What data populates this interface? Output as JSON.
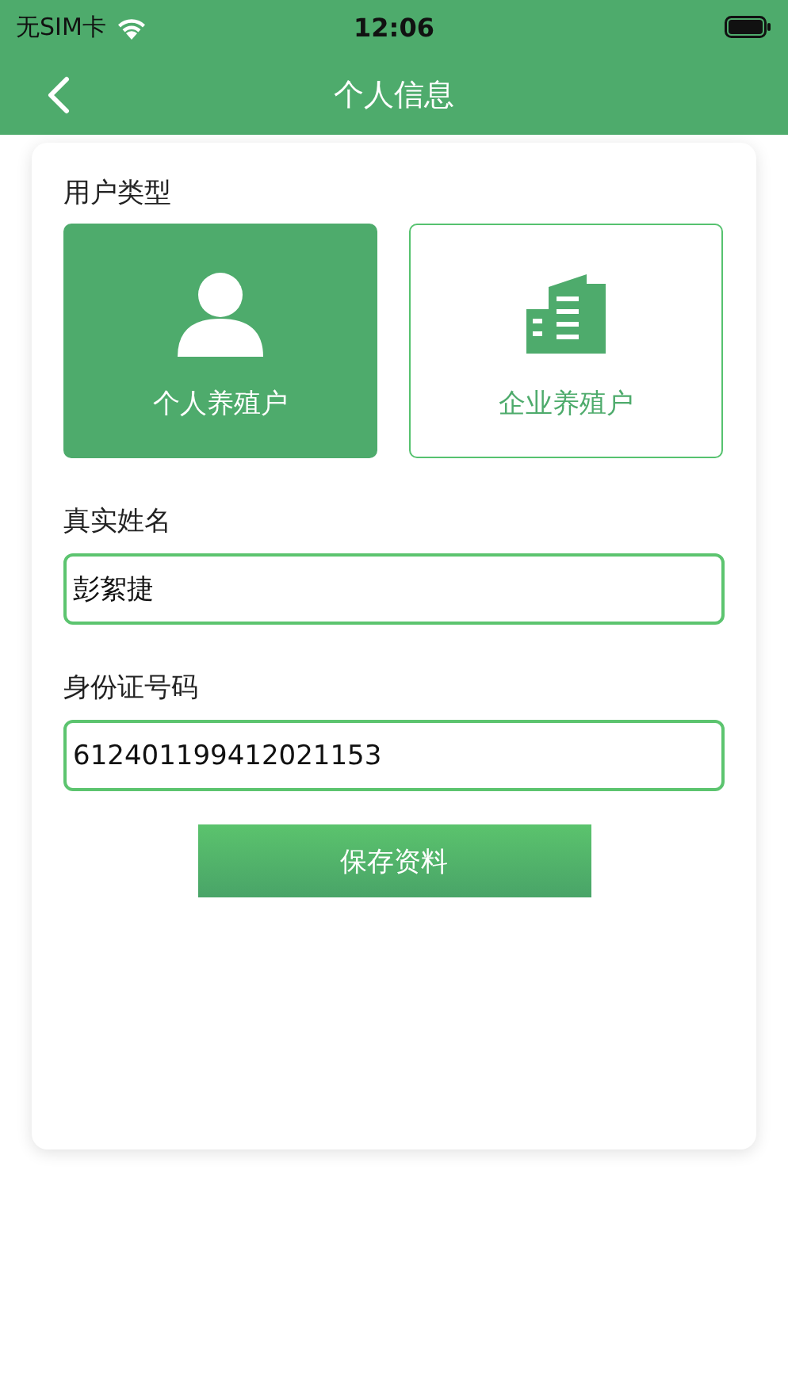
{
  "status_bar": {
    "carrier": "无SIM卡",
    "time": "12:06"
  },
  "nav": {
    "title": "个人信息"
  },
  "user_type": {
    "label": "用户类型",
    "options": [
      {
        "kind": "person",
        "label": "个人养殖户",
        "selected": true
      },
      {
        "kind": "building",
        "label": "企业养殖户",
        "selected": false
      }
    ]
  },
  "fields": [
    {
      "label": "真实姓名",
      "value": "彭絮捷"
    },
    {
      "label": "身份证号码",
      "value": "612401199412021153"
    }
  ],
  "save_button": "保存资料"
}
